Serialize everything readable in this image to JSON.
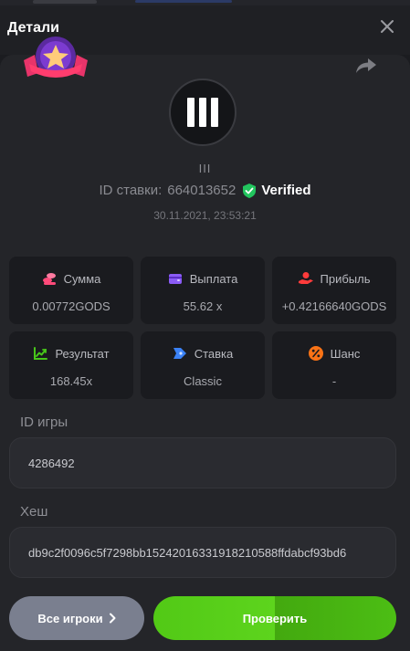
{
  "header": {
    "title": "Детали"
  },
  "game": {
    "name": "III"
  },
  "bet": {
    "id_label": "ID ставки:",
    "id_value": "664013652",
    "verified": "Verified",
    "datetime": "30.11.2021, 23:53:21"
  },
  "stats": [
    {
      "label": "Сумма",
      "value": "0.00772GODS",
      "icon": "coins-icon",
      "color": "#ff4a7a"
    },
    {
      "label": "Выплата",
      "value": "55.62 x",
      "icon": "wallet-icon",
      "color": "#8b5cf6"
    },
    {
      "label": "Прибыль",
      "value": "+0.42166640GODS",
      "icon": "hand-coin-icon",
      "color": "#ff3b3b"
    },
    {
      "label": "Результат",
      "value": "168.45x",
      "icon": "chart-up-icon",
      "color": "#48c71a"
    },
    {
      "label": "Ставка",
      "value": "Classic",
      "icon": "tag-icon",
      "color": "#3b82f6"
    },
    {
      "label": "Шанс",
      "value": "-",
      "icon": "percent-icon",
      "color": "#f97316"
    }
  ],
  "game_id": {
    "label": "ID игры",
    "value": "4286492"
  },
  "hash": {
    "label": "Хеш",
    "value": "db9c2f0096c5f7298bb15242016331918210588ffdabcf93bd6"
  },
  "buttons": {
    "all_players": "Все игроки",
    "verify": "Проверить"
  }
}
